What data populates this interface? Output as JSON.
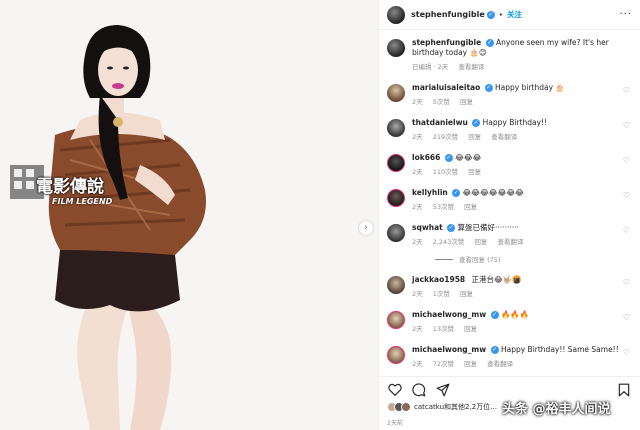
{
  "post": {
    "username": "stephenfungible",
    "follow_label": "关注",
    "caption_text": "Anyone seen my wife? It's her birthday today 🎂😊",
    "caption_meta": [
      "已编辑",
      "· 2天",
      "查看翻译"
    ],
    "photo_logo_cn": "電影傳說",
    "photo_logo_en": "FILM LEGEND"
  },
  "comments": [
    {
      "user": "marialuisaleitao",
      "text": "Happy birthday 🎂",
      "meta": [
        "2天",
        "5次赞",
        "回复"
      ]
    },
    {
      "user": "thatdanielwu",
      "text": "Happy Birthday!!",
      "meta": [
        "2天",
        "219次赞",
        "回复",
        "查看翻译"
      ]
    },
    {
      "user": "lok666",
      "text": "😂😂😂",
      "meta": [
        "2天",
        "110次赞",
        "回复"
      ]
    },
    {
      "user": "kellyhlin",
      "text": "😂😂😂😂😂😂😂",
      "meta": [
        "2天",
        "53次赞",
        "回复"
      ]
    },
    {
      "user": "sqwhat",
      "text": "算盤已備好··········",
      "meta": [
        "2天",
        "2,243次赞",
        "回复",
        "查看翻译"
      ]
    },
    {
      "user": "jackkao1958",
      "text": "正港台😂🤟🏼🍘",
      "meta": [
        "2天",
        "1次赞",
        "回复"
      ]
    },
    {
      "user": "michaelwong_mw",
      "text": "🔥🔥🔥",
      "meta": [
        "2天",
        "13次赞",
        "回复"
      ]
    },
    {
      "user": "michaelwong_mw",
      "text": "Happy Birthday!! Same Same!!",
      "meta": [
        "2天",
        "72次赞",
        "回复",
        "查看翻译"
      ]
    }
  ],
  "replies_toggle": "查看回复 (75)",
  "likes_text": "catcatku和其他2.2万位…",
  "posted_time": "2天前",
  "watermark": "头条 @裕丰人间说",
  "icons": [
    "heart-icon",
    "comment-icon",
    "share-icon",
    "bookmark-icon",
    "more-icon",
    "verified-badge-icon",
    "chevron-right-icon"
  ],
  "colors": {
    "accent": "#0095f6",
    "verified": "#3897f0",
    "muted": "#8e8e8e"
  }
}
